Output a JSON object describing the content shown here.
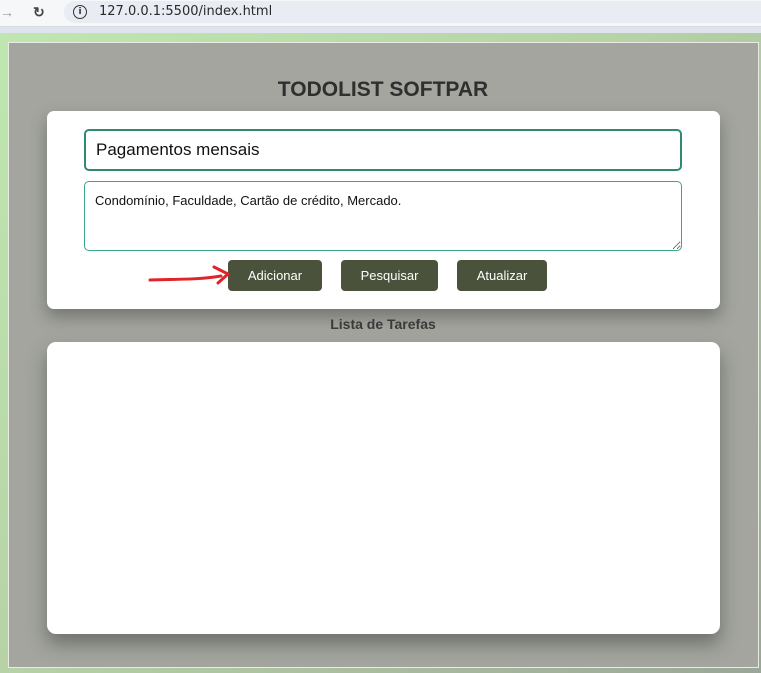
{
  "browser": {
    "url": "127.0.0.1:5500/index.html",
    "forward_icon": "arrow-right-icon",
    "reload_icon": "reload-icon",
    "info_icon": "info-icon"
  },
  "app": {
    "title": "TODOLIST SOFTPAR"
  },
  "form": {
    "title_value": "Pagamentos mensais",
    "description_value": "Condomínio, Faculdade, Cartão de crédito, Mercado."
  },
  "buttons": {
    "add_label": "Adicionar",
    "search_label": "Pesquisar",
    "update_label": "Atualizar"
  },
  "list": {
    "title": "Lista de Tarefas",
    "items": []
  },
  "colors": {
    "button_bg": "#4a523c",
    "page_bg": "#a3a59e",
    "input_border": "#2f8a72",
    "annotation_arrow": "#e0242a"
  }
}
